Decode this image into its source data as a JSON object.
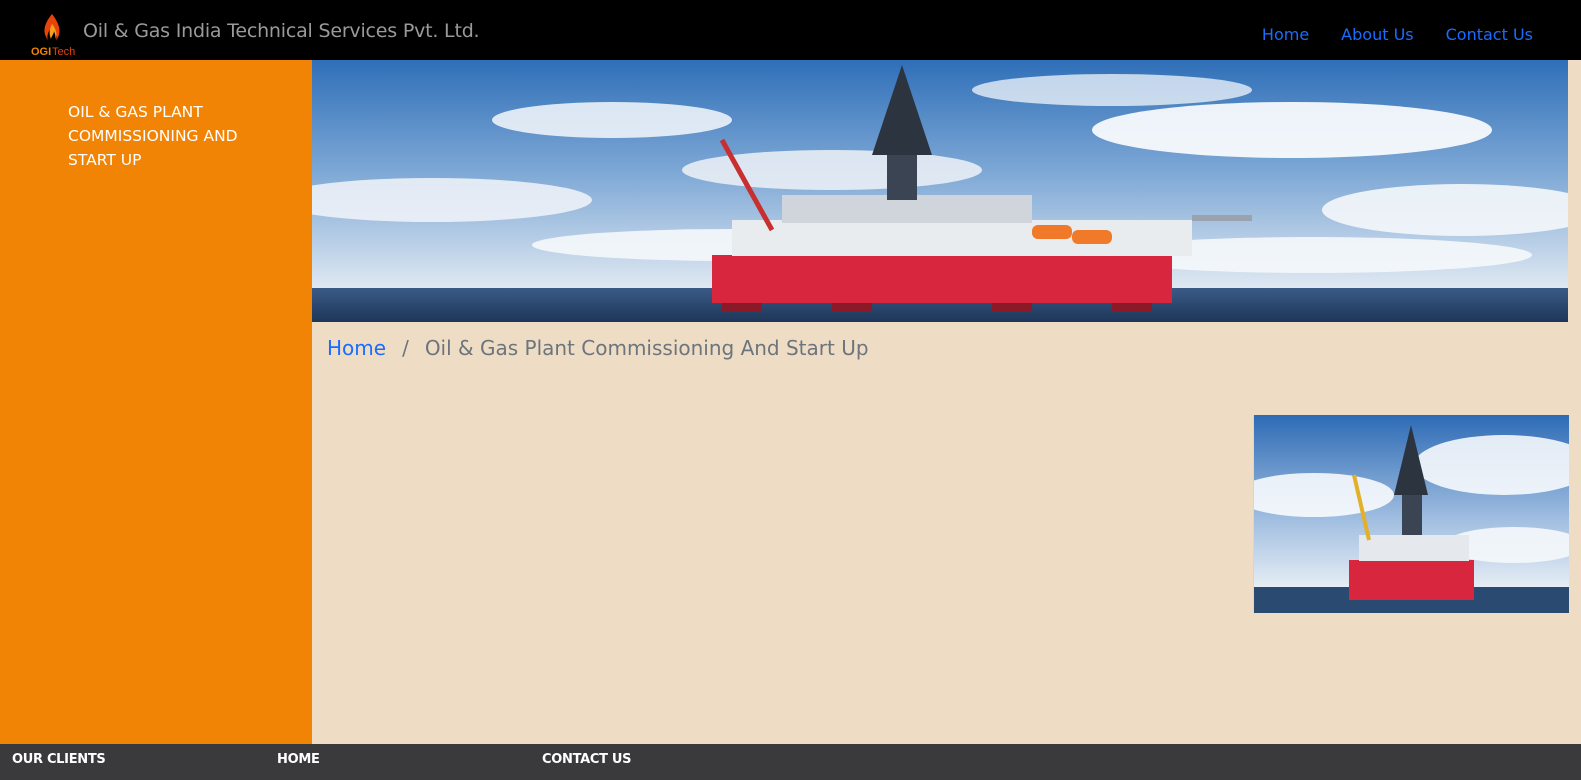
{
  "header": {
    "logo_text": "OGITech",
    "brand": "Oil & Gas India Technical Services Pvt. Ltd.",
    "nav": [
      "Home",
      "About Us",
      "Contact Us"
    ],
    "link_color": "#1a6cff"
  },
  "sidebar": {
    "background": "#f18305",
    "items": [
      {
        "label": "OIL & GAS PLANT COMMISSIONING AND START UP"
      }
    ]
  },
  "main": {
    "background": "#eeddc4",
    "hero_image": "offshore-drilling-rig-photo",
    "breadcrumb": {
      "home": "Home",
      "separator": "/",
      "current": "Oil & Gas Plant Commissioning And Start Up"
    },
    "thumbnail_image": "offshore-rig-thumbnail-photo"
  },
  "footer": {
    "background": "#3a3a3c",
    "columns": [
      "OUR CLIENTS",
      "HOME",
      "CONTACT US"
    ]
  }
}
